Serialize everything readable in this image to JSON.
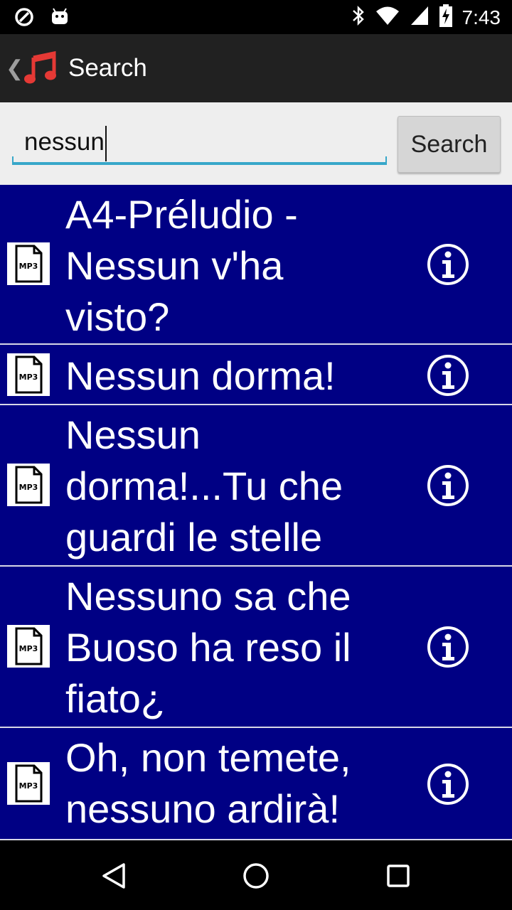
{
  "status_bar": {
    "time": "7:43"
  },
  "action_bar": {
    "title": "Search"
  },
  "search": {
    "query": "nessun",
    "button_label": "Search"
  },
  "results": [
    {
      "title": "A4-Préludio - Nessun v'ha visto?",
      "file_type": "MP3"
    },
    {
      "title": "Nessun dorma!",
      "file_type": "MP3"
    },
    {
      "title": "Nessun dorma!...Tu che guardi le stelle",
      "file_type": "MP3"
    },
    {
      "title": "Nessuno sa che Buoso ha reso il fiato¿",
      "file_type": "MP3"
    },
    {
      "title": "Oh, non temete, nessuno ardirà!",
      "file_type": "MP3"
    }
  ],
  "colors": {
    "list_background": "#000084",
    "action_bar": "#212121",
    "accent": "#37a7c9",
    "app_icon": "#e53935"
  }
}
